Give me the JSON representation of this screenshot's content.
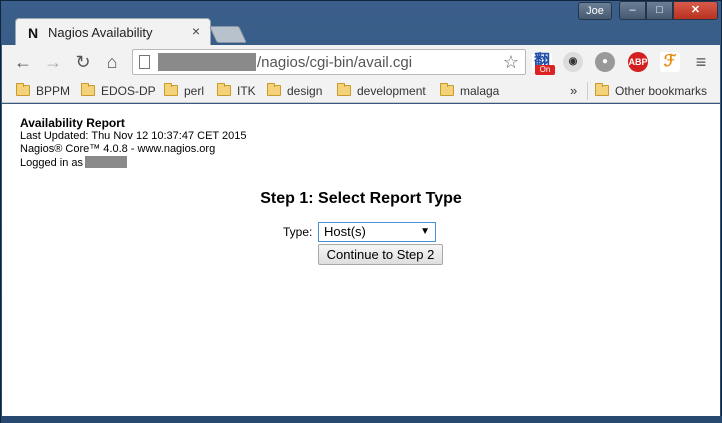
{
  "browser": {
    "tab": {
      "favicon": "N",
      "title": "Nagios Availability",
      "close": "×"
    },
    "user_button": "Joe",
    "window_controls": {
      "minimize": "–",
      "maximize": "□",
      "close": "✕"
    },
    "nav": {
      "back": "←",
      "forward": "→",
      "reload": "↻",
      "home": "⌂"
    },
    "url_path": "/nagios/cgi-bin/avail.cgi",
    "star": "☆",
    "menu": "≡",
    "extensions": [
      {
        "name": "translate-extension-icon",
        "glyph": "翻",
        "badge": "On"
      },
      {
        "name": "eye-extension-icon",
        "glyph": "◉"
      },
      {
        "name": "ghost-extension-icon",
        "glyph": "●"
      },
      {
        "name": "adblock-plus-icon",
        "glyph": "ABP"
      },
      {
        "name": "script-extension-icon",
        "glyph": "ℱ"
      }
    ]
  },
  "bookmarks": {
    "items": [
      "BPPM",
      "EDOS-DP",
      "perl",
      "ITK",
      "design",
      "development",
      "malaga"
    ],
    "more": "»",
    "other": "Other bookmarks"
  },
  "page": {
    "report_title": "Availability Report",
    "last_updated": "Last Updated: Thu Nov 12 10:37:47 CET 2015",
    "version": "Nagios® Core™ 4.0.8 - www.nagios.org",
    "logged_in": "Logged in as",
    "step_title": "Step 1: Select Report Type",
    "type_label": "Type:",
    "type_value": "Host(s)",
    "continue_button": "Continue to Step 2"
  },
  "colors": {
    "accent": "#4a90d9",
    "folder": "#f3d27a"
  }
}
